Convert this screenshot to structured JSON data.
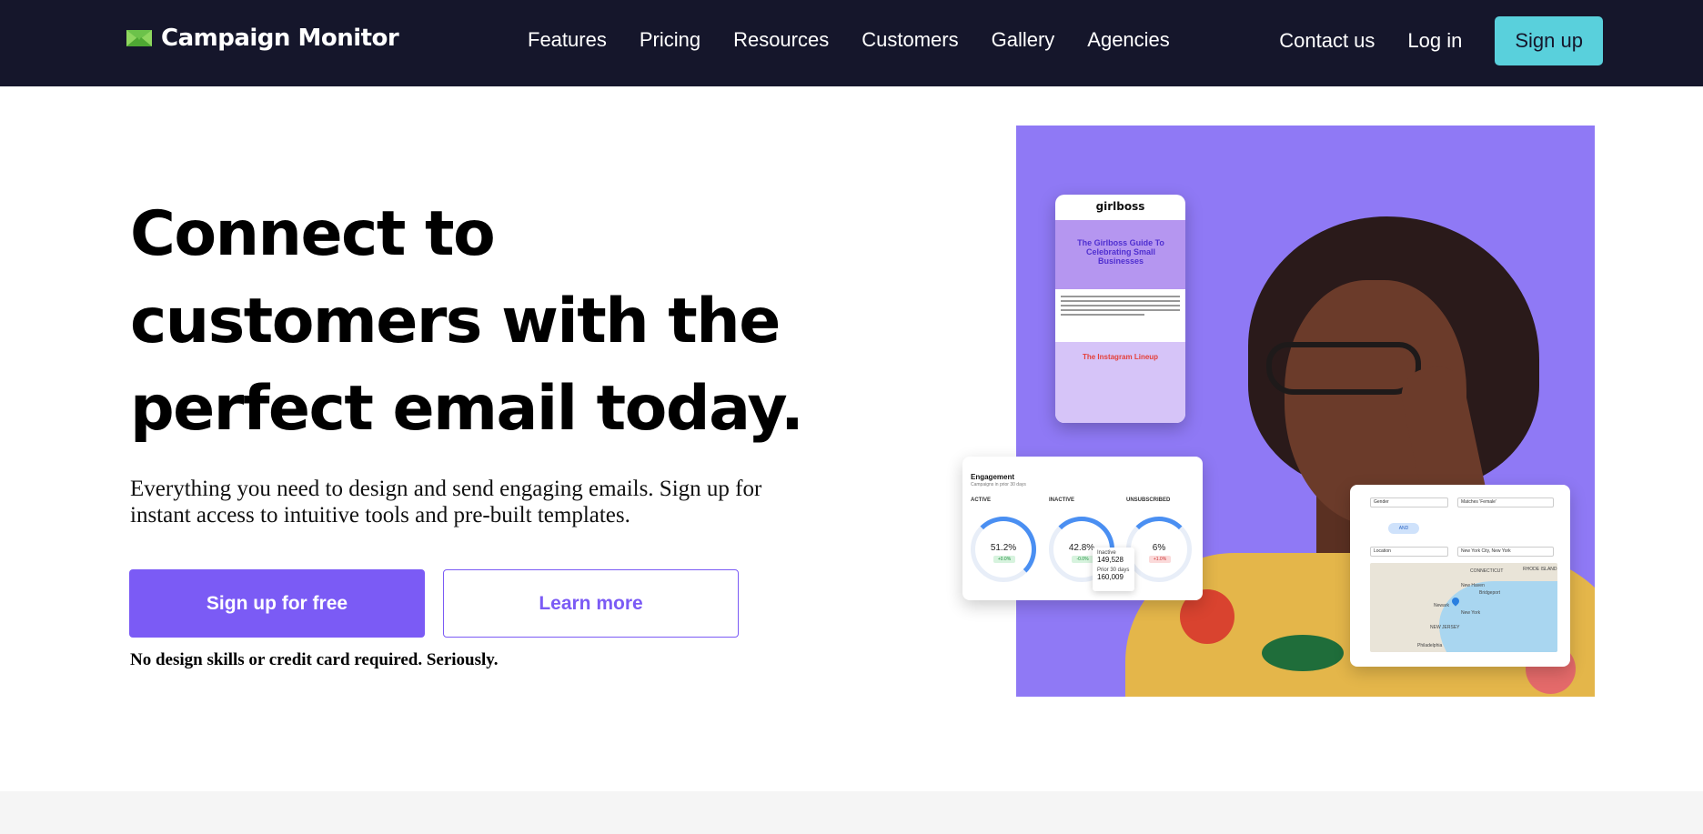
{
  "nav": {
    "brand": "Campaign Monitor",
    "links": [
      "Features",
      "Pricing",
      "Resources",
      "Customers",
      "Gallery",
      "Agencies"
    ],
    "contact": "Contact us",
    "login": "Log in",
    "signup": "Sign up"
  },
  "hero": {
    "title": "Connect to customers with the perfect email today.",
    "subtitle": "Everything you need to design and send engaging emails. Sign up for instant access to intuitive tools and pre-built templates.",
    "cta_primary": "Sign up for free",
    "cta_secondary": "Learn more",
    "fine_print": "No design skills or credit card required. Seriously."
  },
  "email_preview": {
    "brand": "girlboss",
    "banner_title": "The Girlboss Guide To Celebrating Small Businesses",
    "section_title": "The Instagram Lineup"
  },
  "engagement": {
    "title": "Engagement",
    "subtitle": "Campaigns in prior 30 days",
    "labels": [
      "ACTIVE",
      "INACTIVE",
      "UNSUBSCRIBED"
    ],
    "values": [
      "51.2%",
      "42.8%",
      "6%"
    ],
    "deltas": [
      "+0.0%",
      "-0.0%",
      "+1.0%"
    ],
    "tooltip_label": "Inactive",
    "tooltip_value": "149,528",
    "tooltip_prior_label": "Prior 30 days",
    "tooltip_prior_value": "160,009"
  },
  "filters": {
    "field1": "Gender",
    "op1": "Matches 'Female'",
    "chip": "AND",
    "field2": "Location",
    "op2": "New York City, New York",
    "map_labels": [
      "CONNECTICUT",
      "RHODE ISLAND",
      "New Haven",
      "Bridgeport",
      "Newark",
      "New York",
      "NEW JERSEY",
      "Philadelphia"
    ]
  },
  "colors": {
    "nav_bg": "#15162b",
    "accent": "#7b5bf5",
    "signup_bg": "#59d0dc",
    "hero_art_bg": "#8f79f5"
  }
}
